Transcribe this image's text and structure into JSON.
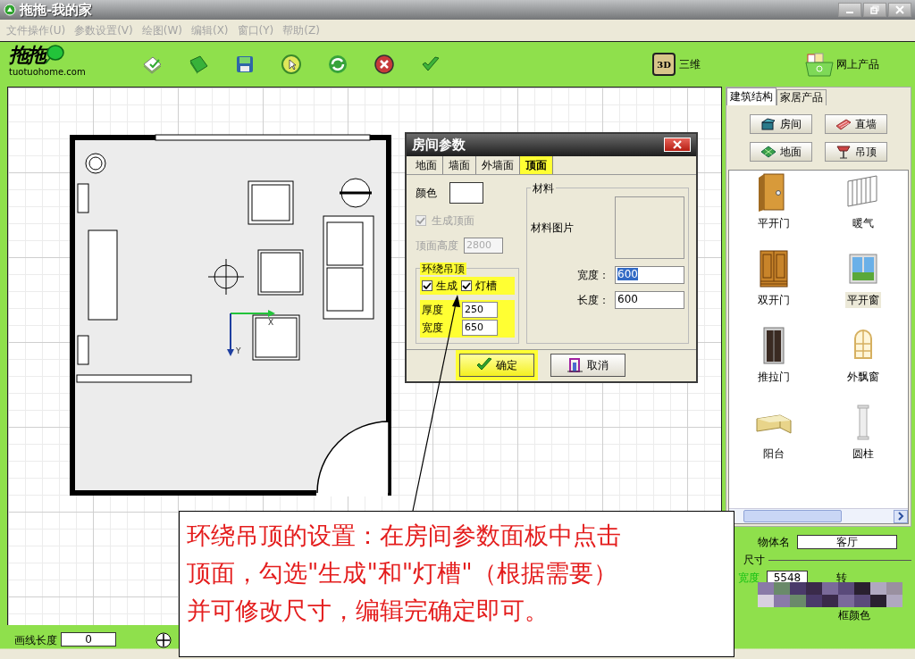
{
  "window": {
    "title": "拖拖-我的家"
  },
  "menu": [
    "文件操作(U)",
    "参数设置(V)",
    "绘图(W)",
    "编辑(X)",
    "窗口(Y)",
    "帮助(Z)"
  ],
  "toolbar": {
    "logo_mark": "拖拖",
    "logo_text": "tuotuohome.com",
    "view_3d": {
      "badge": "3D",
      "label": "三维"
    },
    "online": {
      "label": "网上产品"
    }
  },
  "canvas": {
    "axis_labels": [
      "X",
      "Y"
    ]
  },
  "dialog": {
    "title": "房间参数",
    "tabs": [
      {
        "label": "地面",
        "selected": false,
        "highlighted": false
      },
      {
        "label": "墙面",
        "selected": false,
        "highlighted": false
      },
      {
        "label": "外墙面",
        "selected": false,
        "highlighted": false
      },
      {
        "label": "顶面",
        "selected": true,
        "highlighted": true
      }
    ],
    "color_label": "颜色",
    "generate_top": {
      "label": "生成顶面",
      "checked": true,
      "disabled": true
    },
    "top_height": {
      "label": "顶面高度",
      "value": "2800",
      "disabled": true
    },
    "surround": {
      "legend": "环绕吊顶",
      "highlighted": true,
      "options": [
        {
          "label": "生成",
          "checked": true
        },
        {
          "label": "灯槽",
          "checked": true
        }
      ],
      "fields": [
        {
          "label": "厚度",
          "value": "250"
        },
        {
          "label": "宽度",
          "value": "650"
        }
      ]
    },
    "material": {
      "legend": "材料",
      "image_label": "材料图片",
      "fields": [
        {
          "label": "宽度：",
          "value": "600",
          "selected": true
        },
        {
          "label": "长度：",
          "value": "600",
          "selected": false
        }
      ]
    },
    "buttons": [
      {
        "label": "确定",
        "highlighted": true
      },
      {
        "label": "取消",
        "highlighted": false
      }
    ]
  },
  "callout": {
    "lines": [
      "环绕吊顶的设置：在房间参数面板中点击",
      "顶面，勾选\"生成\"和\"灯槽\"（根据需要）",
      "并可修改尺寸，编辑完确定即可。"
    ]
  },
  "side_panel": {
    "tabs": [
      {
        "label": "建筑结构",
        "selected": true
      },
      {
        "label": "家居产品",
        "selected": false
      }
    ],
    "buttons": [
      "房间",
      "直墙",
      "地面",
      "吊顶"
    ],
    "items": [
      {
        "label": "平开门",
        "selected": false
      },
      {
        "label": "暖气",
        "selected": false
      },
      {
        "label": "双开门",
        "selected": false
      },
      {
        "label": "平开窗",
        "selected": true
      },
      {
        "label": "推拉门",
        "selected": false
      },
      {
        "label": "外飘窗",
        "selected": false
      },
      {
        "label": "阳台",
        "selected": false
      },
      {
        "label": "圆柱",
        "selected": false
      }
    ]
  },
  "properties": {
    "name_label": "物体名",
    "name_value": "客厅",
    "size_legend": "尺寸",
    "width_label": "宽度",
    "width_value": "5548",
    "rotate_label": "转",
    "color_label": "框颜色"
  },
  "status": {
    "length_label": "画线长度",
    "length_value": "0"
  }
}
